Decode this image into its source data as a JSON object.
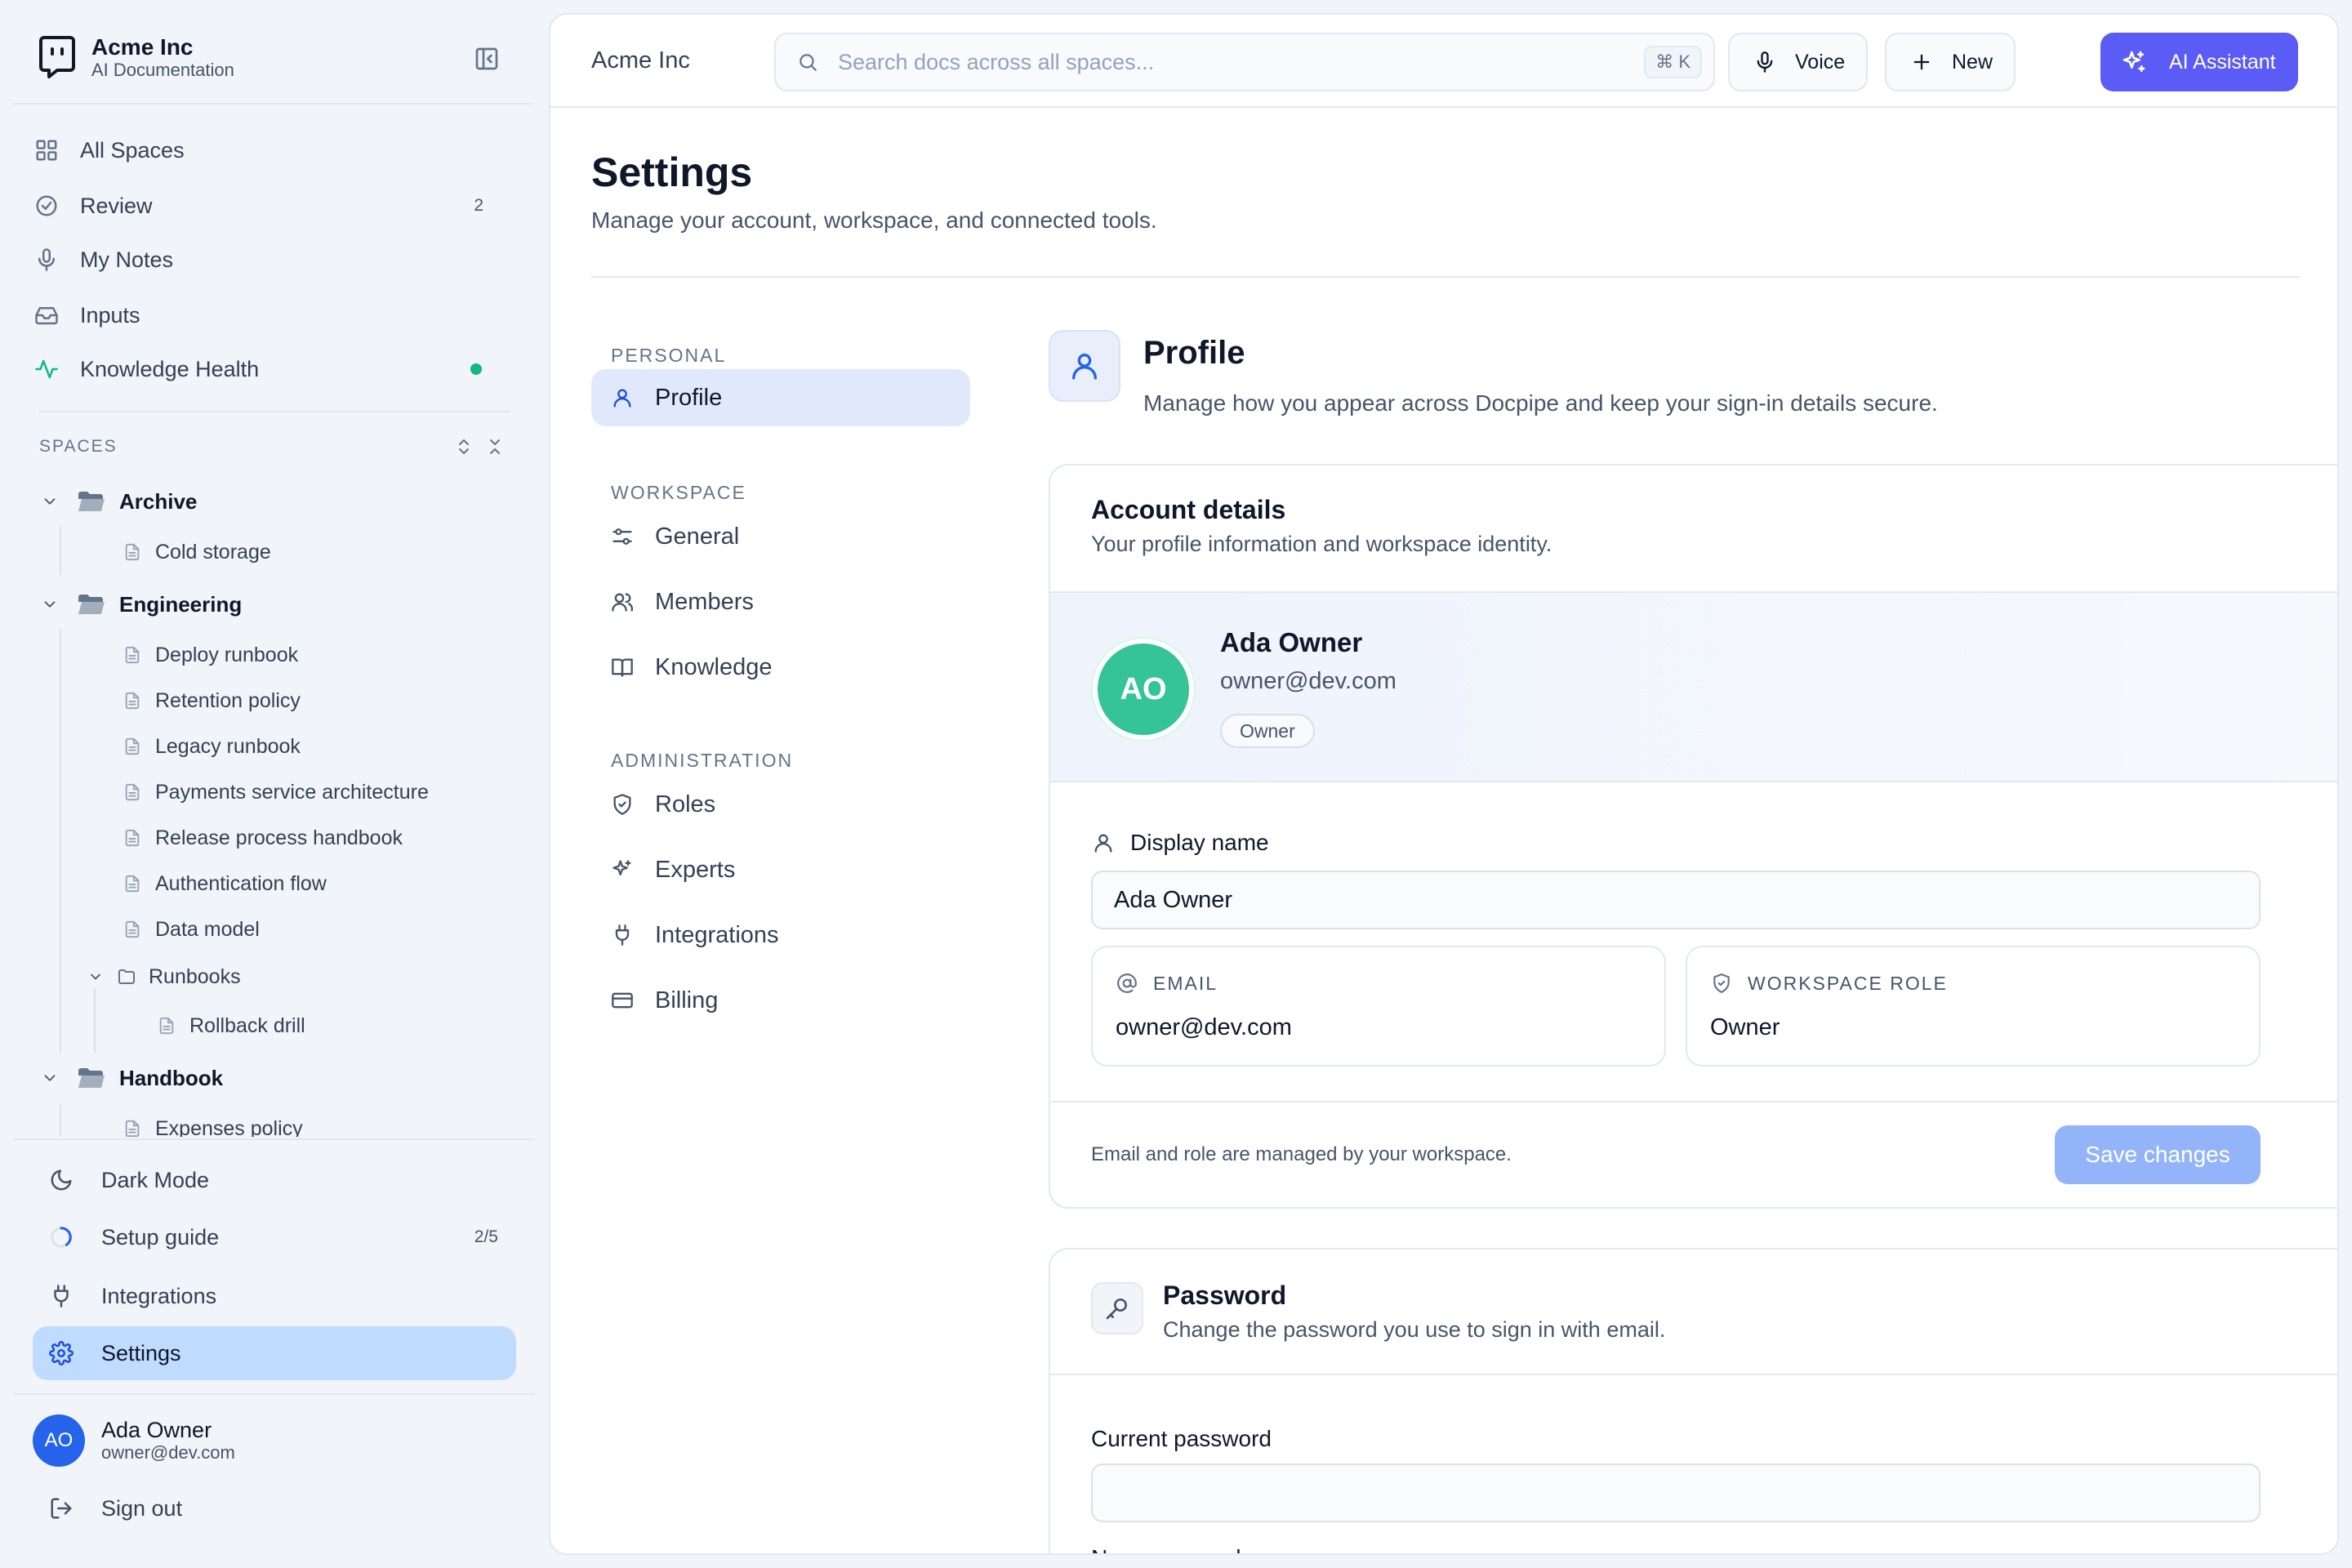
{
  "brand": {
    "name": "Acme Inc",
    "subtitle": "AI Documentation"
  },
  "sidebar": {
    "nav": [
      {
        "label": "All Spaces",
        "icon": "grid-icon"
      },
      {
        "label": "Review",
        "icon": "check-circle-icon",
        "badge": "2"
      },
      {
        "label": "My Notes",
        "icon": "mic-icon"
      },
      {
        "label": "Inputs",
        "icon": "inbox-icon"
      },
      {
        "label": "Knowledge Health",
        "icon": "activity-icon",
        "status_color": "#10b981"
      }
    ],
    "spaces_heading": "SPACES",
    "tree": {
      "archive": {
        "label": "Archive",
        "docs": [
          "Cold storage"
        ]
      },
      "engineering": {
        "label": "Engineering",
        "docs": [
          "Deploy runbook",
          "Retention policy",
          "Legacy runbook",
          "Payments service architecture",
          "Release process handbook",
          "Authentication flow",
          "Data model"
        ],
        "subfolder": {
          "label": "Runbooks",
          "docs": [
            "Rollback drill"
          ]
        }
      },
      "handbook": {
        "label": "Handbook",
        "docs": [
          "Expenses policy"
        ]
      }
    },
    "bottom": [
      {
        "label": "Dark Mode",
        "icon": "moon-icon"
      },
      {
        "label": "Setup guide",
        "icon": "progress-ring-icon",
        "badge": "2/5",
        "progress": 0.4
      },
      {
        "label": "Integrations",
        "icon": "plug-icon"
      },
      {
        "label": "Settings",
        "icon": "gear-icon",
        "active": true
      }
    ],
    "user": {
      "initials": "AO",
      "name": "Ada Owner",
      "email": "owner@dev.com"
    },
    "sign_out": "Sign out"
  },
  "topbar": {
    "workspace": "Acme Inc",
    "search_placeholder": "Search docs across all spaces...",
    "search_shortcut": "⌘ K",
    "voice_label": "Voice",
    "new_label": "New",
    "ai_label": "AI Assistant"
  },
  "page": {
    "title": "Settings",
    "subtitle": "Manage your account, workspace, and connected tools."
  },
  "settings_nav": {
    "personal_heading": "PERSONAL",
    "personal": [
      {
        "label": "Profile",
        "icon": "user-icon",
        "active": true
      }
    ],
    "workspace_heading": "WORKSPACE",
    "workspace": [
      {
        "label": "General",
        "icon": "sliders-icon"
      },
      {
        "label": "Members",
        "icon": "users-icon"
      },
      {
        "label": "Knowledge",
        "icon": "book-open-icon"
      }
    ],
    "admin_heading": "ADMINISTRATION",
    "admin": [
      {
        "label": "Roles",
        "icon": "shield-icon"
      },
      {
        "label": "Experts",
        "icon": "sparkles-icon"
      },
      {
        "label": "Integrations",
        "icon": "plug-icon"
      },
      {
        "label": "Billing",
        "icon": "credit-card-icon"
      }
    ]
  },
  "profile": {
    "title": "Profile",
    "subtitle": "Manage how you appear across Docpipe and keep your sign-in details secure.",
    "account": {
      "title": "Account details",
      "subtitle": "Your profile information and workspace identity.",
      "initials": "AO",
      "name": "Ada Owner",
      "email": "owner@dev.com",
      "role_badge": "Owner",
      "display_name_label": "Display name",
      "display_name_value": "Ada Owner",
      "email_label": "EMAIL",
      "email_value": "owner@dev.com",
      "role_label": "WORKSPACE ROLE",
      "role_value": "Owner",
      "footnote": "Email and role are managed by your workspace.",
      "save_label": "Save changes"
    },
    "password": {
      "title": "Password",
      "subtitle": "Change the password you use to sign in with email.",
      "current_label": "Current password",
      "new_label": "New password"
    }
  },
  "colors": {
    "accent": "#5b5bf5",
    "active_bg": "#bfdbfe",
    "avatar_green": "#34c495",
    "avatar_blue": "#2563eb",
    "save_disabled": "#93b4f8"
  }
}
